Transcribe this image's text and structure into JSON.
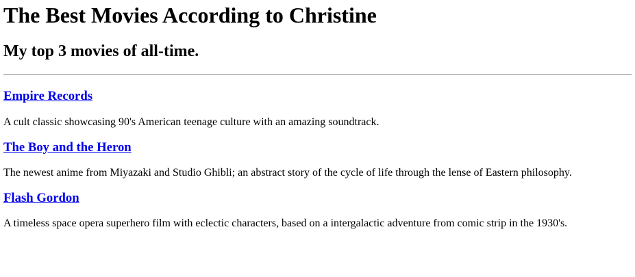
{
  "page": {
    "title": "The Best Movies According to Christine",
    "subtitle": "My top 3 movies of all-time."
  },
  "movies": [
    {
      "title": "Empire Records",
      "description": "A cult classic showcasing 90's American teenage culture with an amazing soundtrack."
    },
    {
      "title": "The Boy and the Heron",
      "description": "The newest anime from Miyazaki and Studio Ghibli; an abstract story of the cycle of life through the lense of Eastern philosophy."
    },
    {
      "title": "Flash Gordon",
      "description": "A timeless space opera superhero film with eclectic characters, based on a intergalactic adventure from comic strip in the 1930's."
    }
  ],
  "colors": {
    "link": "#0000ee",
    "text": "#000000",
    "divider": "#9a9a9a"
  }
}
